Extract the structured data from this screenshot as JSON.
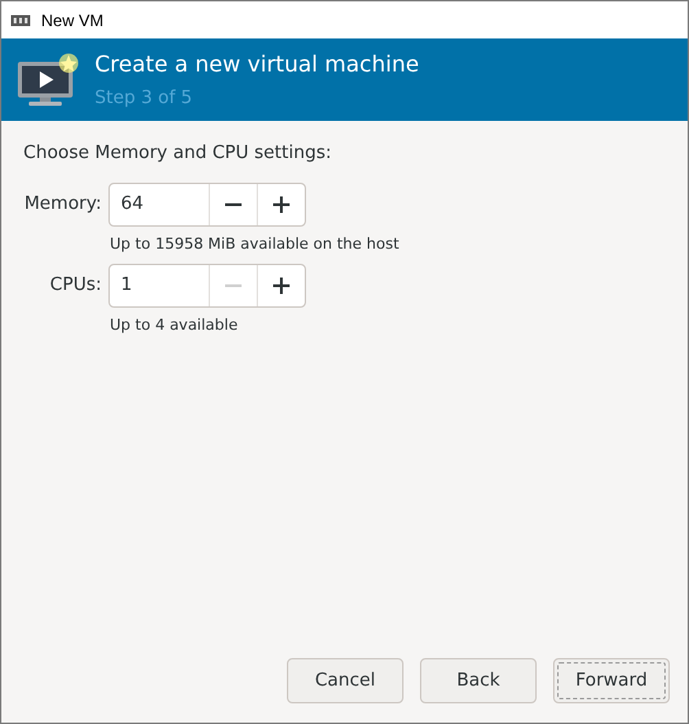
{
  "window": {
    "title": "New VM"
  },
  "banner": {
    "title": "Create a new virtual machine",
    "step": "Step 3 of 5"
  },
  "heading": "Choose Memory and CPU settings:",
  "fields": [
    {
      "label": "Memory:",
      "value": "64",
      "decrement_disabled": false,
      "increment_disabled": false,
      "hint": "Up to 15958 MiB available on the host"
    },
    {
      "label": "CPUs:",
      "value": "1",
      "decrement_disabled": true,
      "increment_disabled": false,
      "hint": "Up to 4 available"
    }
  ],
  "buttons": [
    {
      "label": "Cancel",
      "focused": false
    },
    {
      "label": "Back",
      "focused": false
    },
    {
      "label": "Forward",
      "focused": true
    }
  ]
}
